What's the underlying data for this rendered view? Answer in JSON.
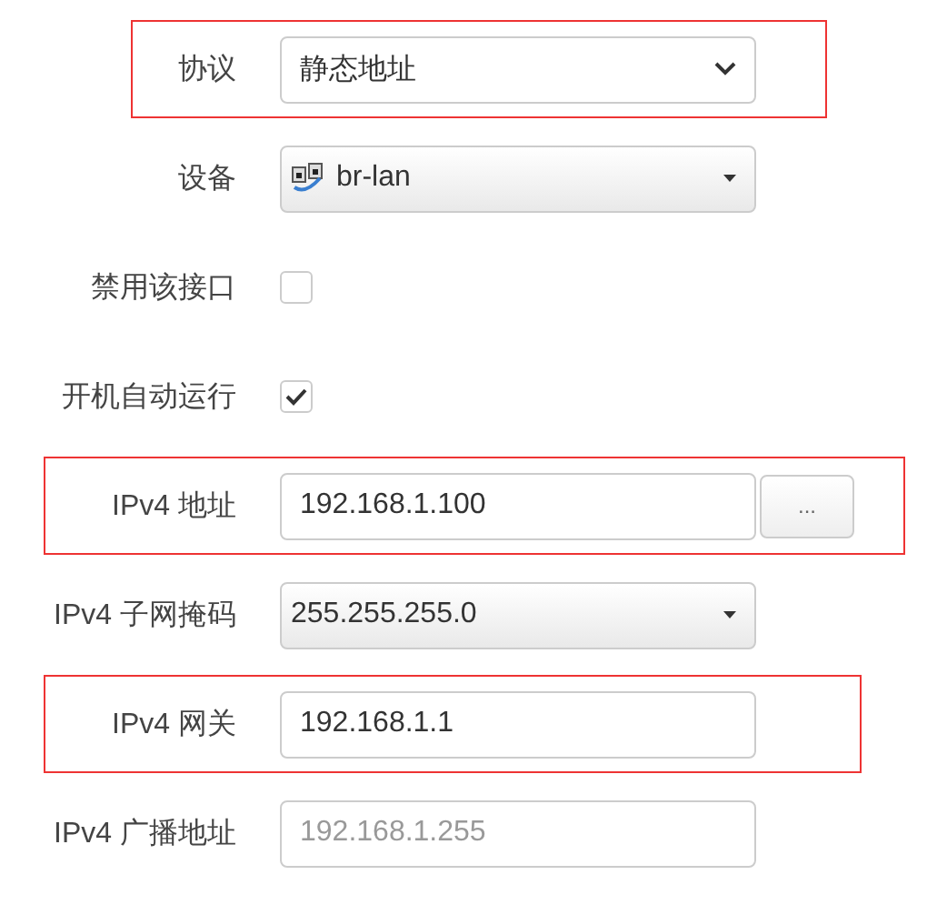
{
  "fields": [
    {
      "kind": "select",
      "label": "协议",
      "value": "静态地址",
      "highlighted": true
    },
    {
      "kind": "device-select",
      "label": "设备",
      "value": "br-lan",
      "highlighted": false
    },
    {
      "kind": "checkbox",
      "label": "禁用该接口",
      "checked": false,
      "highlighted": false
    },
    {
      "kind": "checkbox",
      "label": "开机自动运行",
      "checked": true,
      "highlighted": false
    },
    {
      "kind": "text-button",
      "label": "IPv4 地址",
      "value": "192.168.1.100",
      "button": "...",
      "highlighted": true
    },
    {
      "kind": "dropdown",
      "label": "IPv4 子网掩码",
      "value": "255.255.255.0",
      "highlighted": false
    },
    {
      "kind": "text",
      "label": "IPv4 网关",
      "value": "192.168.1.1",
      "highlighted": true
    },
    {
      "kind": "text",
      "label": "IPv4 广播地址",
      "placeholder": "192.168.1.255",
      "highlighted": false
    }
  ]
}
